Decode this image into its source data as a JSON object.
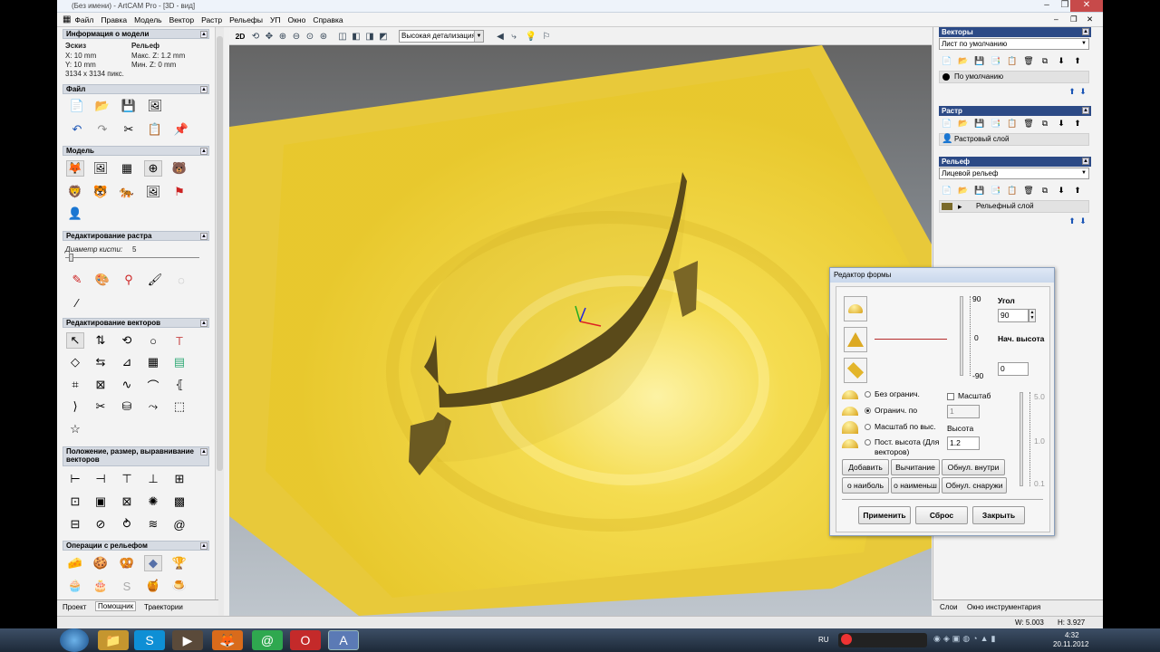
{
  "window": {
    "title": "(Без имени) - ArtCAM Pro - [3D - вид]",
    "controls": [
      "–",
      "❐",
      "✕"
    ],
    "inner_controls": [
      "–",
      "❐",
      "✕"
    ]
  },
  "menu": [
    "Файл",
    "Правка",
    "Модель",
    "Вектор",
    "Растр",
    "Рельефы",
    "УП",
    "Окно",
    "Справка"
  ],
  "left_panel": {
    "model_info": {
      "header": "Информация о модели",
      "col1_title": "Эскиз",
      "col1_lines": [
        "X: 10 mm",
        "Y: 10 mm"
      ],
      "col2_title": "Рельеф",
      "col2_lines": [
        "Макс. Z: 1.2 mm",
        "Мин. Z: 0 mm"
      ],
      "pixels": "3134 x 3134 пикс."
    },
    "file_header": "Файл",
    "model_header": "Модель",
    "raster_edit_header": "Редактирование растра",
    "brush_label": "Диаметр кисти:",
    "brush_value": "5",
    "vector_edit_header": "Редактирование векторов",
    "position_header": "Положение, размер, выравнивание векторов",
    "relief_ops_header": "Операции с рельефом",
    "tabs": [
      "Проект",
      "Помощник",
      "Траектории"
    ]
  },
  "view_toolbar": {
    "mode": "2D",
    "detail": "Высокая детализация"
  },
  "right_panel": {
    "vectors": {
      "header": "Векторы",
      "sheet": "Лист по умолчанию",
      "layer": "По умолчанию"
    },
    "raster": {
      "header": "Растр",
      "layer": "Растровый слой"
    },
    "relief": {
      "header": "Рельеф",
      "combo": "Лицевой рельеф",
      "layer": "Рельефный слой"
    },
    "tabs": [
      "Слои",
      "Окно инструментария"
    ]
  },
  "status": {
    "w": "W: 5.003",
    "h": "H: 3.927"
  },
  "shape_editor": {
    "title": "Редактор формы",
    "angle_label": "Угол",
    "angle_value": "90",
    "slider_top": "90",
    "slider_mid": "0",
    "slider_bottom": "-90",
    "start_height_label": "Нач. высота",
    "start_height_value": "0",
    "options": [
      "Без огранич.",
      "Огранич. по",
      "Масштаб по выс.",
      "Пост. высота (Для векторов)"
    ],
    "selected_option": 1,
    "scale_label": "Масштаб",
    "scale_value": "1",
    "height_label": "Высота",
    "height_value": "1.2",
    "scale_ticks": [
      "5.0",
      "1.0",
      "0.1"
    ],
    "buttons_row1": [
      "Добавить",
      "Вычитание",
      "Обнул. внутри"
    ],
    "buttons_row2": [
      "о наиболь",
      "о наименьш",
      "Обнул. снаружи"
    ],
    "buttons_row3": [
      "Применить",
      "Сброс",
      "Закрыть"
    ]
  },
  "taskbar": {
    "lang": "RU",
    "time": "4:32",
    "date": "20.11.2012"
  },
  "colors": {
    "relief_yellow": "#f2d63c",
    "panel_header": "#2c4a86"
  }
}
